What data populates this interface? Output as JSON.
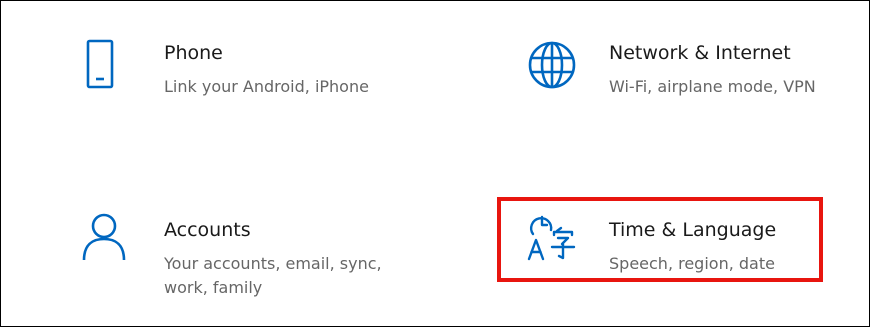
{
  "colors": {
    "accent": "#0067c0",
    "highlight": "#e8150f",
    "title": "#1a1a1a",
    "description": "#666666"
  },
  "tiles": [
    {
      "icon": "phone-icon",
      "title": "Phone",
      "description": "Link your Android, iPhone"
    },
    {
      "icon": "globe-icon",
      "title": "Network & Internet",
      "description": "Wi-Fi, airplane mode, VPN"
    },
    {
      "icon": "person-icon",
      "title": "Accounts",
      "description": "Your accounts, email, sync, work, family"
    },
    {
      "icon": "time-language-icon",
      "title": "Time & Language",
      "description": "Speech, region, date"
    }
  ]
}
